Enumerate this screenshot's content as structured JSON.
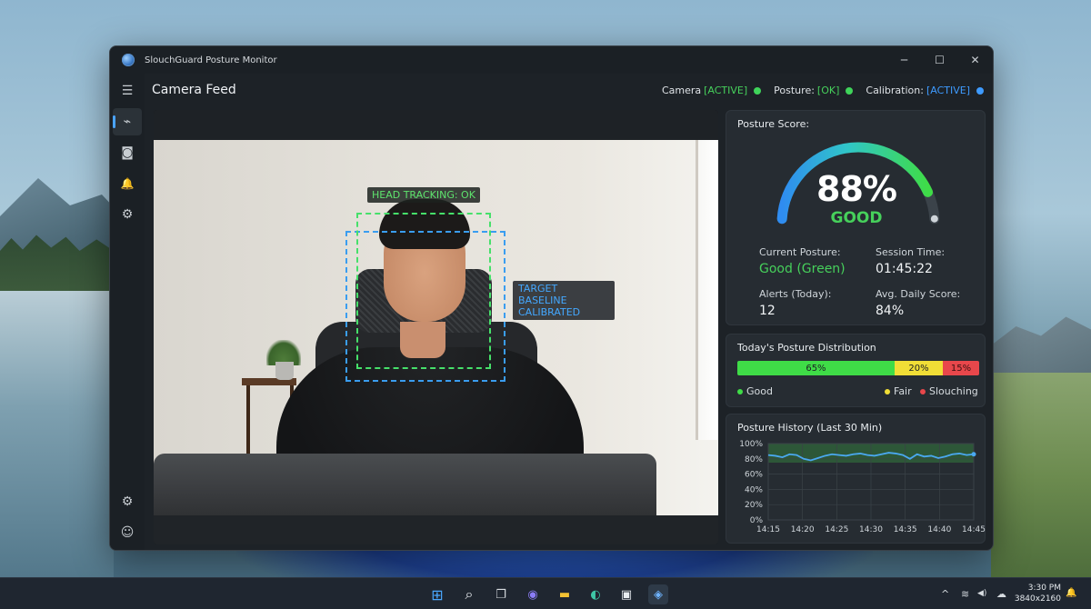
{
  "window": {
    "title": "SlouchGuard Posture Monitor",
    "controls": {
      "minimize": "─",
      "maximize": "☐",
      "close": "✕"
    }
  },
  "sidebar": {
    "items": [
      {
        "icon": "hamburger-menu-icon",
        "glyph": "☰"
      },
      {
        "icon": "waveform-icon",
        "glyph": "⌁",
        "active": true
      },
      {
        "icon": "camera-icon",
        "glyph": "◙"
      },
      {
        "icon": "bell-icon",
        "glyph": "🔔"
      },
      {
        "icon": "gear-icon",
        "glyph": "⚙"
      }
    ],
    "bottom_items": [
      {
        "icon": "settings-gear-icon",
        "glyph": "⚙"
      },
      {
        "icon": "user-profile-icon",
        "glyph": "☺"
      }
    ]
  },
  "header": {
    "title": "Camera Feed",
    "statuses": [
      {
        "name": "Camera",
        "state": "[ACTIVE]",
        "color": "#46d05b"
      },
      {
        "name": "Posture:",
        "state": "[OK]",
        "color": "#46d05b"
      },
      {
        "name": "Calibration:",
        "state": "[ACTIVE]",
        "color": "#3e9bff"
      }
    ]
  },
  "camera": {
    "head_label": "HEAD TRACKING: OK",
    "target_label_line1": "TARGET BASELINE",
    "target_label_line2": "CALIBRATED"
  },
  "score_card": {
    "title": "Posture Score:",
    "score_percent": 88,
    "score_text": "88%",
    "score_label": "GOOD",
    "current_posture_label": "Current Posture:",
    "current_posture_value": "Good (Green)",
    "session_time_label": "Session Time:",
    "session_time_value": "01:45:22",
    "alerts_label": "Alerts (Today):",
    "alerts_value": "12",
    "avg_label": "Avg. Daily Score:",
    "avg_value": "84%"
  },
  "distribution": {
    "title": "Today's Posture Distribution",
    "segments": [
      {
        "label": "65%",
        "value": 65,
        "color": "#3fdc47"
      },
      {
        "label": "20%",
        "value": 20,
        "color": "#f1de36"
      },
      {
        "label": "15%",
        "value": 15,
        "color": "#e8474b"
      }
    ],
    "legend": {
      "good": "Good",
      "fair": "Fair",
      "slouching": "Slouching"
    }
  },
  "history": {
    "title": "Posture History (Last 30 Min)"
  },
  "chart_data": {
    "type": "line",
    "title": "Posture History (Last 30 Min)",
    "x_ticks": [
      "14:15",
      "14:20",
      "14:25",
      "14:30",
      "14:35",
      "14:40",
      "14:45"
    ],
    "y_ticks": [
      "100%",
      "80%",
      "60%",
      "40%",
      "20%",
      "0%"
    ],
    "ylim": [
      0,
      100
    ],
    "good_band": [
      75,
      100
    ],
    "series": [
      {
        "color": "#4aa8f0",
        "values": [
          85,
          84,
          82,
          86,
          85,
          80,
          78,
          81,
          84,
          86,
          85,
          84,
          86,
          87,
          85,
          84,
          86,
          88,
          87,
          85,
          80,
          86,
          83,
          84,
          81,
          83,
          86,
          87,
          85,
          86
        ]
      }
    ]
  },
  "taskbar": {
    "clock_time": "3:30 PM",
    "clock_sub": "3840x2160",
    "apps": [
      {
        "icon": "windows-start-icon",
        "glyph": "⊞"
      },
      {
        "icon": "search-icon",
        "glyph": "⌕"
      },
      {
        "icon": "task-view-icon",
        "glyph": "❐"
      },
      {
        "icon": "teams-chat-icon",
        "glyph": "◉"
      },
      {
        "icon": "file-explorer-icon",
        "glyph": "▬"
      },
      {
        "icon": "edge-browser-icon",
        "glyph": "◐"
      },
      {
        "icon": "store-icon",
        "glyph": "▣"
      },
      {
        "icon": "slouchguard-app-icon",
        "glyph": "◈"
      }
    ],
    "tray": {
      "chevron": "^",
      "wifi": "≋",
      "volume": "◀)",
      "cloud": "☁",
      "bell": "🔔"
    }
  }
}
